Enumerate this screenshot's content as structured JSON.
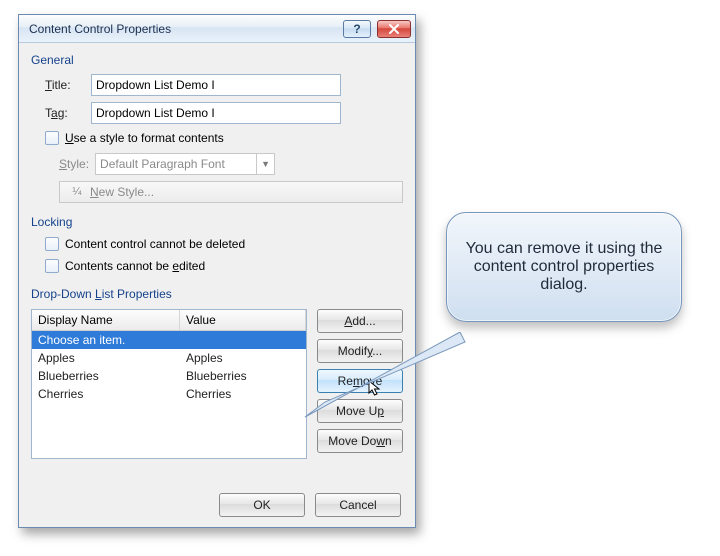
{
  "dialog": {
    "title": "Content Control Properties",
    "sections": {
      "general": "General",
      "locking": "Locking",
      "dropdown": "Drop-Down List Properties"
    },
    "title_label": "Title:",
    "tag_label": "Tag:",
    "title_value": "Dropdown List Demo I",
    "tag_value": "Dropdown List Demo I",
    "use_style_label": "Use a style to format contents",
    "style_label": "Style:",
    "style_value": "Default Paragraph Font",
    "new_style_label": "New Style...",
    "lock_delete_label": "Content control cannot be deleted",
    "lock_edit_label": "Contents cannot be edited",
    "list": {
      "col_display": "Display Name",
      "col_value": "Value",
      "rows": [
        {
          "display": "Choose an item.",
          "value": ""
        },
        {
          "display": "Apples",
          "value": "Apples"
        },
        {
          "display": "Blueberries",
          "value": "Blueberries"
        },
        {
          "display": "Cherries",
          "value": "Cherries"
        }
      ],
      "selected_index": 0
    },
    "buttons": {
      "add": "Add...",
      "modify": "Modify...",
      "remove": "Remove",
      "move_up": "Move Up",
      "move_down": "Move Down",
      "ok": "OK",
      "cancel": "Cancel"
    }
  },
  "callout": {
    "text": "You can remove it using the content control properties dialog."
  }
}
